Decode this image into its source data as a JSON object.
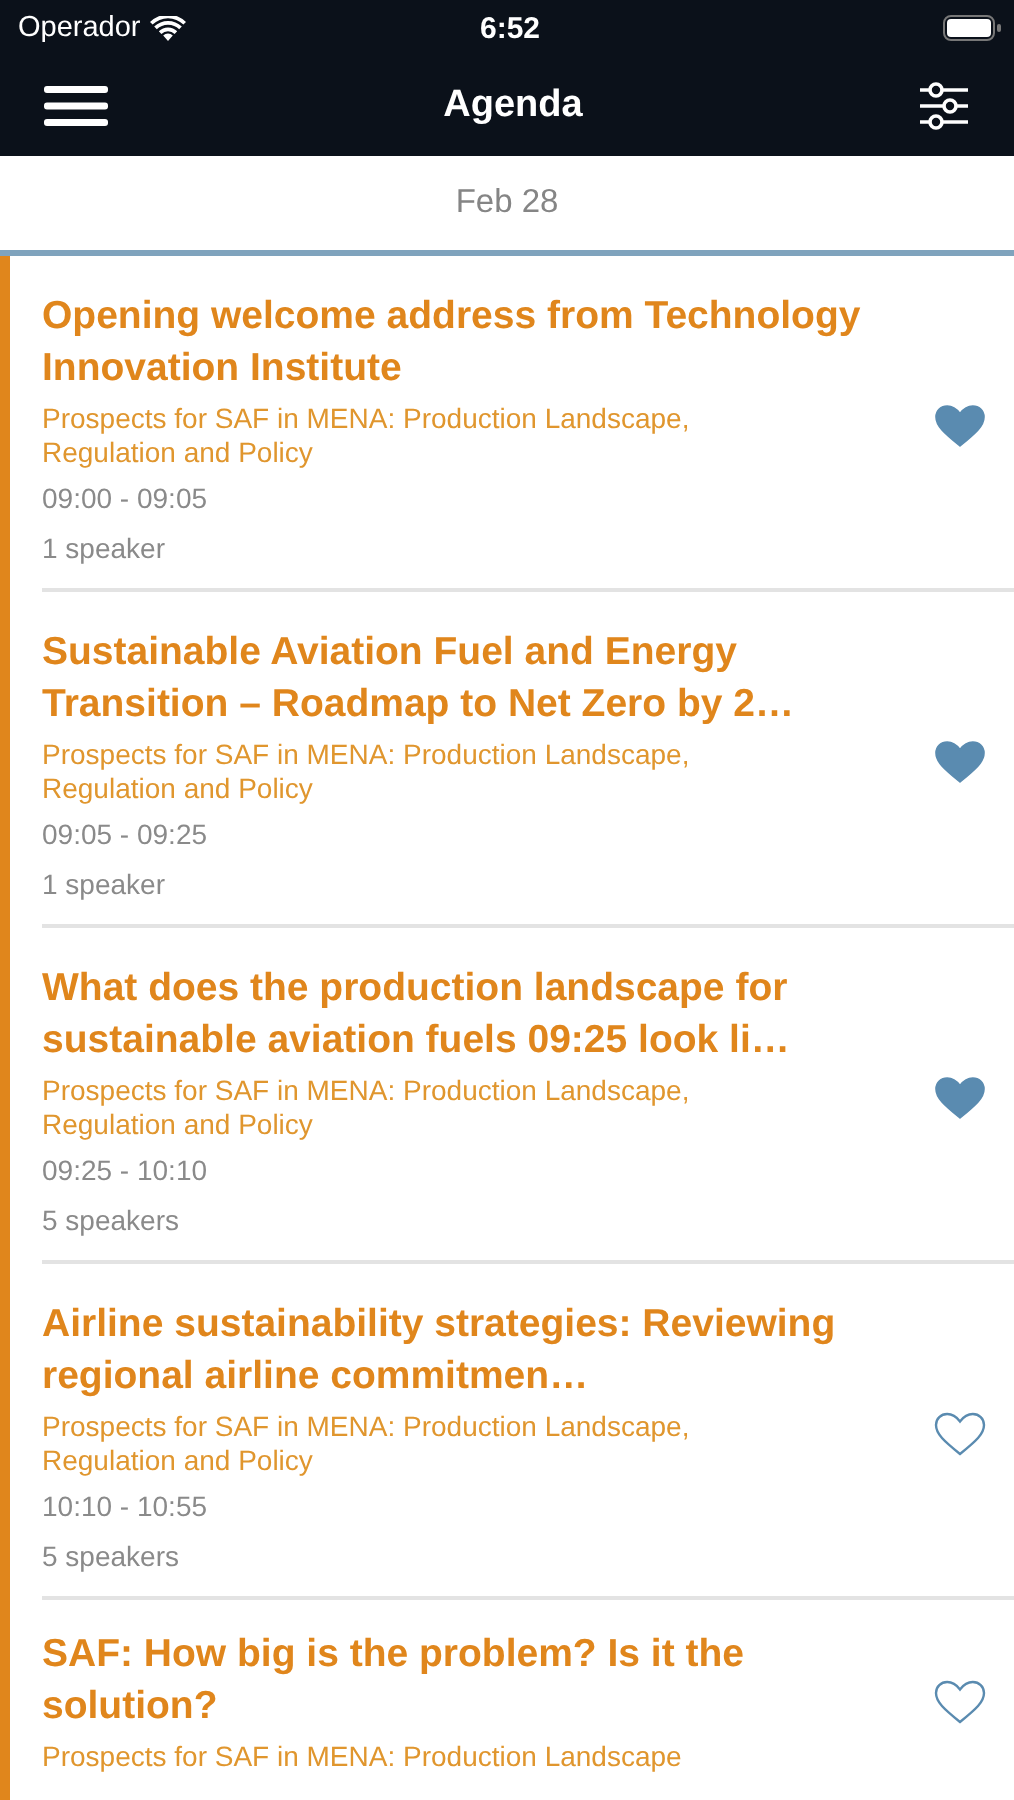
{
  "status_bar": {
    "carrier": "Operador",
    "time": "6:52"
  },
  "nav": {
    "title": "Agenda"
  },
  "date": "Feb 28",
  "sessions": [
    {
      "title": "Opening welcome address from Technology Innovation Institute",
      "track": "Prospects for SAF in MENA: Production Landscape, Regulation and Policy",
      "time": "09:00 - 09:05",
      "speakers": "1 speaker",
      "favorite": true
    },
    {
      "title": "Sustainable Aviation Fuel and Energy Transition – Roadmap to Net Zero by 2…",
      "track": "Prospects for SAF in MENA: Production Landscape, Regulation and Policy",
      "time": "09:05 - 09:25",
      "speakers": "1 speaker",
      "favorite": true
    },
    {
      "title": "What does the production landscape for sustainable aviation fuels 09:25 look li…",
      "track": "Prospects for SAF in MENA: Production Landscape, Regulation and Policy",
      "time": "09:25 - 10:10",
      "speakers": "5 speakers",
      "favorite": true
    },
    {
      "title": "Airline sustainability strategies: Reviewing regional airline commitmen…",
      "track": "Prospects for SAF in MENA: Production Landscape, Regulation and Policy",
      "time": "10:10 - 10:55",
      "speakers": "5 speakers",
      "favorite": false
    },
    {
      "title": "SAF: How big is the problem? Is it the solution?",
      "track": "Prospects for SAF in MENA: Production Landscape",
      "favorite": false
    }
  ]
}
